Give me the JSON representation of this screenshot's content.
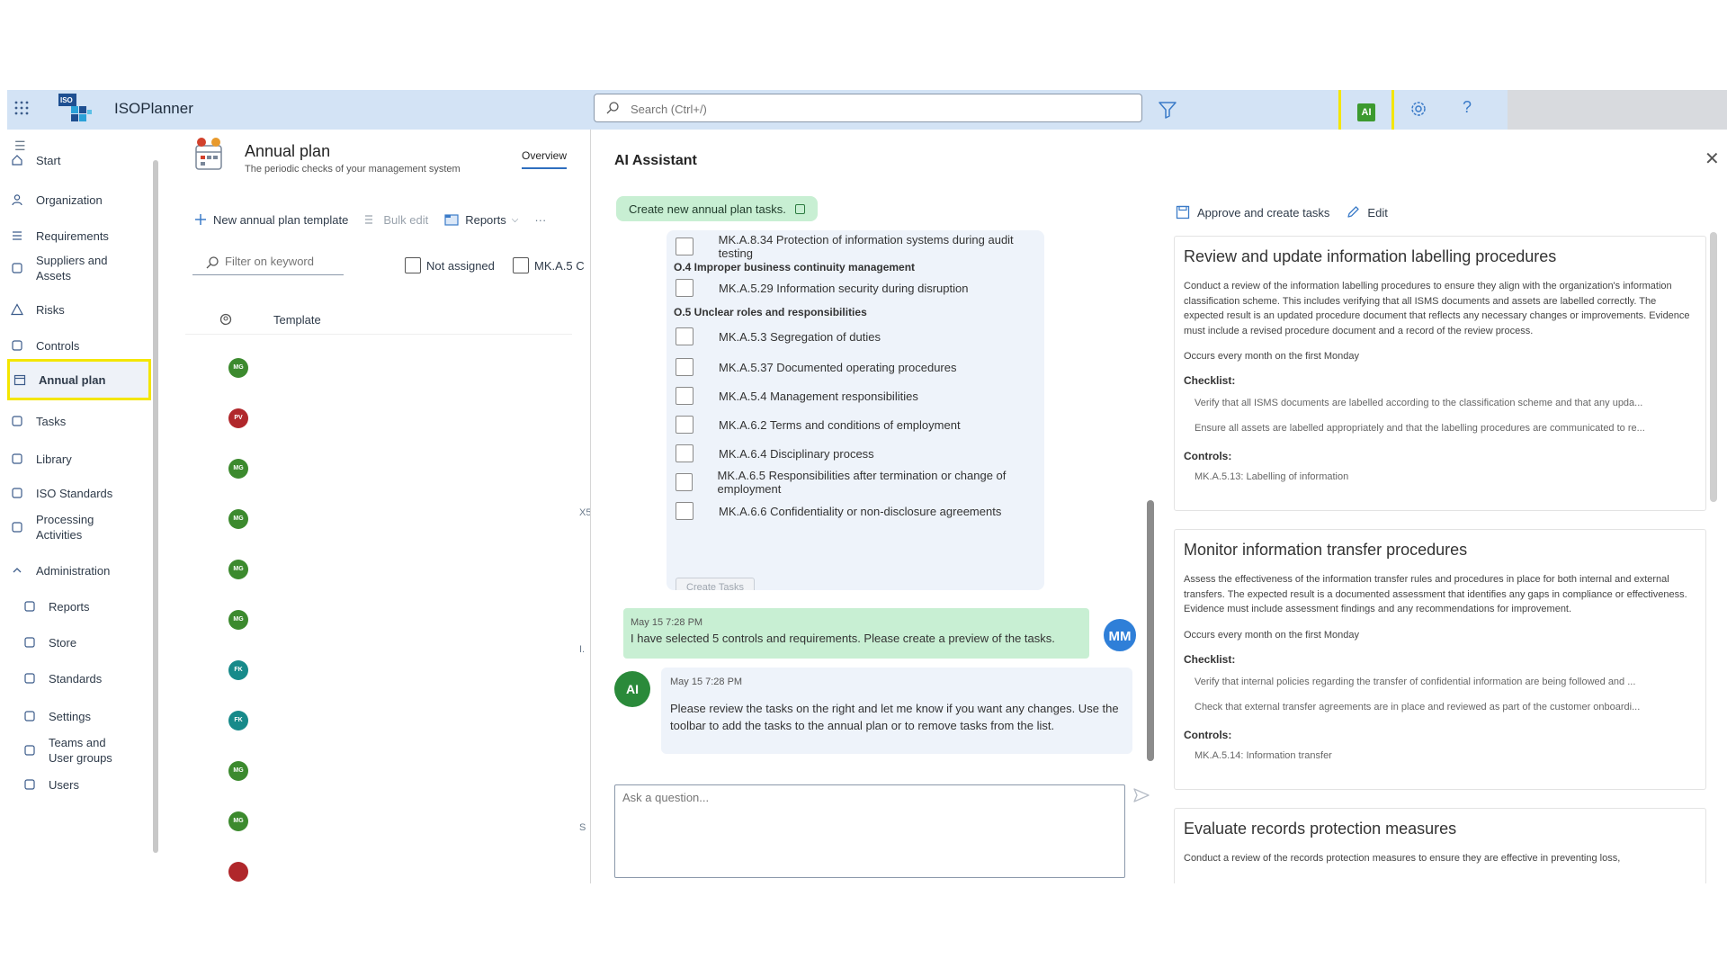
{
  "app": {
    "name": "ISOPlanner",
    "search_placeholder": "Search (Ctrl+/)",
    "ai_button_label": "AI",
    "logo_text": "ISO"
  },
  "nav": {
    "items": [
      {
        "label": "Start",
        "icon": "home-icon"
      },
      {
        "label": "Organization",
        "icon": "person-icon"
      },
      {
        "label": "Requirements",
        "icon": "list-icon"
      },
      {
        "label": "Suppliers and Assets",
        "icon": "supplier-icon"
      },
      {
        "label": "Risks",
        "icon": "warning-icon"
      },
      {
        "label": "Controls",
        "icon": "controls-icon"
      },
      {
        "label": "Annual plan",
        "icon": "calendar-icon"
      },
      {
        "label": "Tasks",
        "icon": "tasks-icon"
      },
      {
        "label": "Library",
        "icon": "library-icon"
      },
      {
        "label": "ISO Standards",
        "icon": "standards-icon"
      },
      {
        "label": "Processing Activities",
        "icon": "processing-icon"
      },
      {
        "label": "Administration",
        "icon": "chevron-up-icon"
      },
      {
        "label": "Reports",
        "icon": "reports-icon"
      },
      {
        "label": "Store",
        "icon": "store-icon"
      },
      {
        "label": "Standards",
        "icon": "standards-admin-icon"
      },
      {
        "label": "Settings",
        "icon": "settings-icon"
      },
      {
        "label": "Teams and User groups",
        "icon": "teams-icon"
      },
      {
        "label": "Users",
        "icon": "users-icon"
      }
    ]
  },
  "list": {
    "title": "Annual plan",
    "subtitle": "The periodic checks of your management system",
    "tab": "Overview",
    "commands": {
      "new_template": "New annual plan template",
      "bulk_edit": "Bulk edit",
      "reports": "Reports",
      "more": "···"
    },
    "filter_placeholder": "Filter on keyword",
    "not_assigned": "Not assigned",
    "mka_filter": "MK.A.5 C",
    "column_template": "Template",
    "avatars": [
      {
        "initials": "MG",
        "color": "#3c8a2e"
      },
      {
        "initials": "PV",
        "color": "#b0272b"
      },
      {
        "initials": "MG",
        "color": "#3c8a2e"
      },
      {
        "initials": "MG",
        "color": "#3c8a2e"
      },
      {
        "initials": "MG",
        "color": "#3c8a2e"
      },
      {
        "initials": "MG",
        "color": "#3c8a2e"
      },
      {
        "initials": "FK",
        "color": "#178a8a"
      },
      {
        "initials": "FK",
        "color": "#178a8a"
      },
      {
        "initials": "MG",
        "color": "#3c8a2e"
      },
      {
        "initials": "MG",
        "color": "#3c8a2e"
      },
      {
        "initials": "",
        "color": "#b0272b"
      }
    ],
    "edge_texts": [
      "X5",
      "I.",
      "S"
    ]
  },
  "assistant": {
    "title": "AI Assistant",
    "chip": "Create new annual plan tasks.",
    "controls": [
      {
        "type": "item",
        "label": "MK.A.8.34 Protection of information systems during audit testing"
      },
      {
        "type": "group",
        "label": "O.4 Improper business continuity management"
      },
      {
        "type": "item",
        "label": "MK.A.5.29 Information security during disruption"
      },
      {
        "type": "group",
        "label": "O.5 Unclear roles and responsibilities"
      },
      {
        "type": "item",
        "label": "MK.A.5.3 Segregation of duties"
      },
      {
        "type": "item",
        "label": "MK.A.5.37 Documented operating procedures"
      },
      {
        "type": "item",
        "label": "MK.A.5.4 Management responsibilities"
      },
      {
        "type": "item",
        "label": "MK.A.6.2 Terms and conditions of employment"
      },
      {
        "type": "item",
        "label": "MK.A.6.4 Disciplinary process"
      },
      {
        "type": "item",
        "label": "MK.A.6.5 Responsibilities after termination or change of employment"
      },
      {
        "type": "item",
        "label": "MK.A.6.6 Confidentiality or non-disclosure agreements"
      }
    ],
    "create_tasks": "Create Tasks",
    "user_msg": {
      "time": "May 15 7:28 PM",
      "text": "I have selected 5 controls and requirements. Please create a preview of the tasks.",
      "initials": "MM"
    },
    "ai_msg": {
      "time": "May 15 7:28 PM",
      "text": "Please review the tasks on the right and let me know if you want any changes. Use the toolbar to add the tasks to the annual plan or to remove tasks from the list.",
      "initials": "AI"
    },
    "ask_placeholder": "Ask a question..."
  },
  "preview": {
    "approve": "Approve and create tasks",
    "edit": "Edit",
    "tasks": [
      {
        "title": "Review and update information labelling procedures",
        "desc": "Conduct a review of the information labelling procedures to ensure they align with the organization's information classification scheme. This includes verifying that all ISMS documents and assets are labelled correctly. The expected result is an updated procedure document that reflects any necessary changes or improvements. Evidence must include a revised procedure document and a record of the review process.",
        "occurs": "Occurs every month on the first Monday",
        "checklist_label": "Checklist:",
        "checklist": [
          "Verify that all ISMS documents are labelled according to the classification scheme and that any upda...",
          "Ensure all assets are labelled appropriately and that the labelling procedures are communicated to re..."
        ],
        "controls_label": "Controls:",
        "controls": "MK.A.5.13: Labelling of information"
      },
      {
        "title": "Monitor information transfer procedures",
        "desc": "Assess the effectiveness of the information transfer rules and procedures in place for both internal and external transfers. The expected result is a documented assessment that identifies any gaps in compliance or effectiveness. Evidence must include assessment findings and any recommendations for improvement.",
        "occurs": "Occurs every month on the first Monday",
        "checklist_label": "Checklist:",
        "checklist": [
          "Verify that internal policies regarding the transfer of confidential information are being followed and ...",
          "Check that external transfer agreements are in place and reviewed as part of the customer onboardi..."
        ],
        "controls_label": "Controls:",
        "controls": "MK.A.5.14: Information transfer"
      },
      {
        "title": "Evaluate records protection measures",
        "desc": "Conduct a review of the records protection measures to ensure they are effective in preventing loss,"
      }
    ]
  }
}
